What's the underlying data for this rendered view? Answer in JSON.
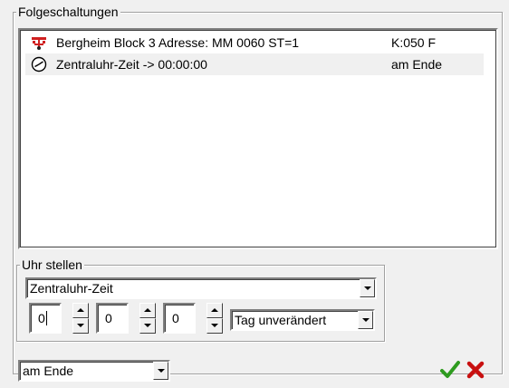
{
  "folgeschaltungen": {
    "title": "Folgeschaltungen",
    "items": [
      {
        "icon": "signal-icon",
        "text": "Bergheim Block 3 Adresse: MM 0060 ST=1",
        "tail": "K:050 F"
      },
      {
        "icon": "clock-icon",
        "text": "Zentraluhr-Zeit -> 00:00:00",
        "tail": "am Ende"
      }
    ]
  },
  "uhr_stellen": {
    "title": "Uhr stellen",
    "clock_select": "Zentraluhr-Zeit",
    "hours": "0",
    "minutes": "0",
    "seconds": "0",
    "day_select": "Tag unverändert"
  },
  "timing_select": "am Ende",
  "colors": {
    "ok": "#2e9b1f",
    "cancel": "#c81010",
    "signal": "#d02020"
  }
}
